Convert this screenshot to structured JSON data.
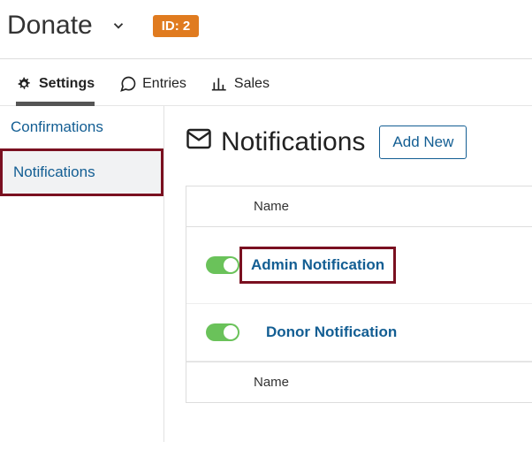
{
  "header": {
    "title": "Donate",
    "id_badge": "ID: 2"
  },
  "tabs": {
    "settings": "Settings",
    "entries": "Entries",
    "sales": "Sales"
  },
  "sidebar": {
    "confirmations": "Confirmations",
    "notifications": "Notifications"
  },
  "page": {
    "title": "Notifications",
    "add_new": "Add New"
  },
  "table": {
    "header_name": "Name",
    "footer_name": "Name",
    "rows": [
      {
        "name": "Admin Notification",
        "on": true
      },
      {
        "name": "Donor Notification",
        "on": true
      }
    ]
  }
}
